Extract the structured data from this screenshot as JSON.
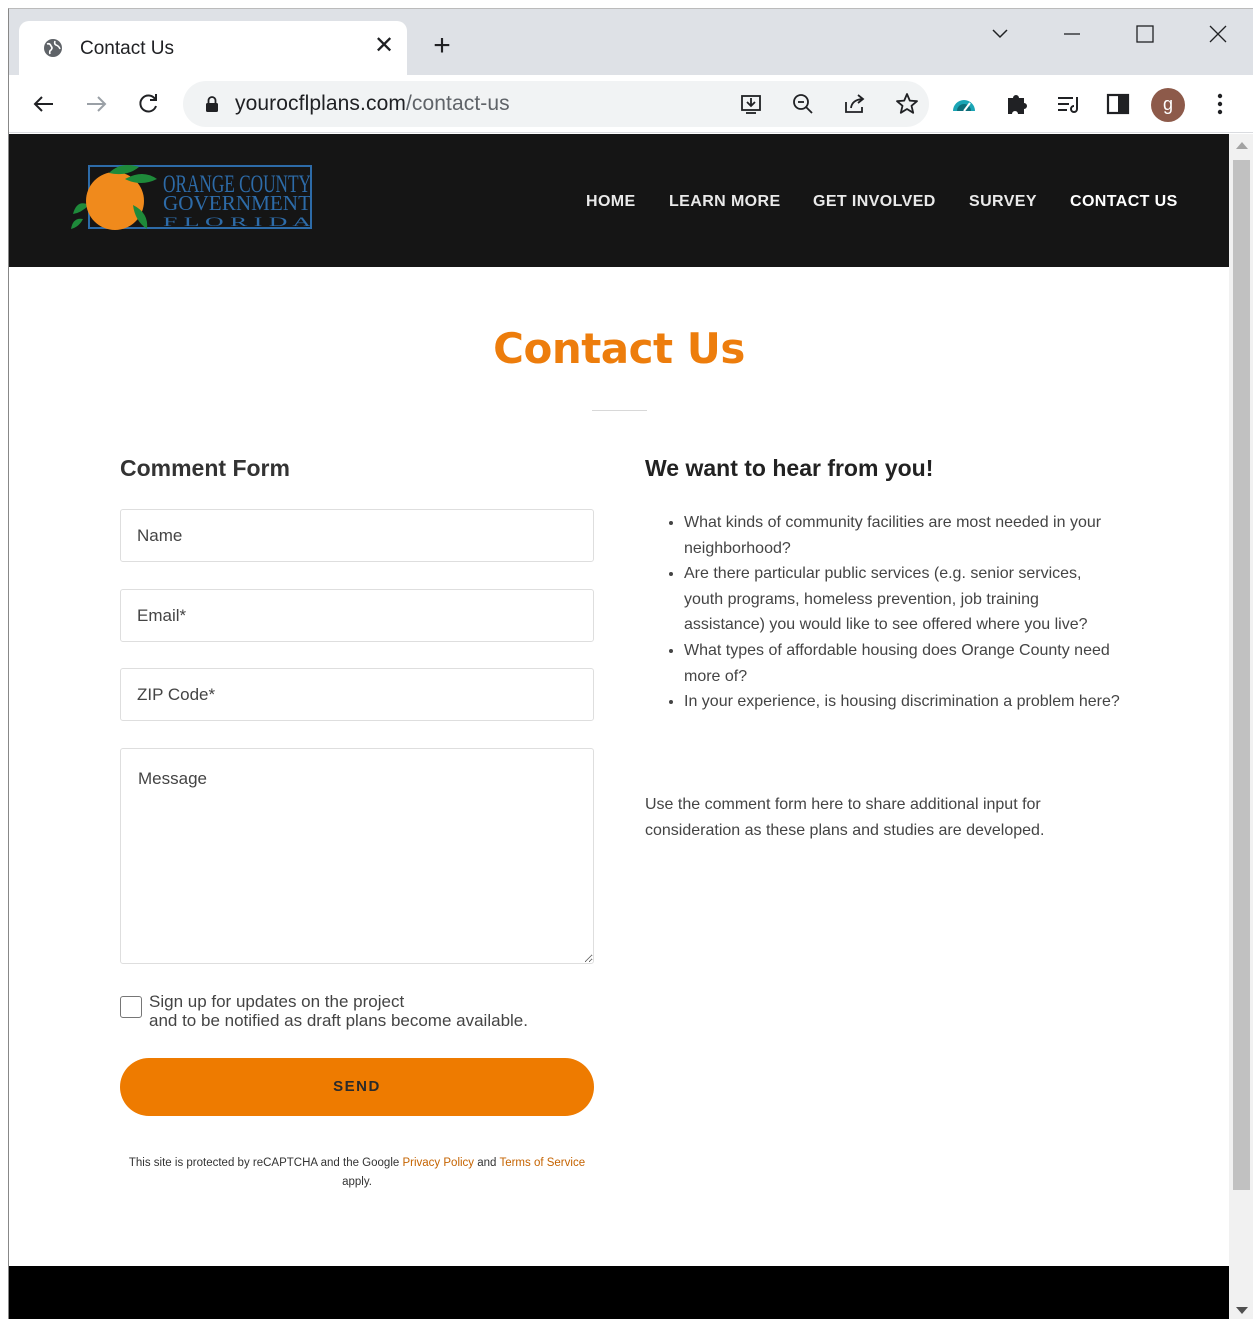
{
  "browser": {
    "tab_title": "Contact Us",
    "url_domain": "yourocflplans.com",
    "url_path": "/contact-us",
    "profile_initial": "g"
  },
  "site": {
    "logo_text": {
      "line1": "ORANGE COUNTY",
      "line2": "GOVERNMENT",
      "line3": "F L O R I D A"
    },
    "nav": [
      {
        "label": "HOME"
      },
      {
        "label": "LEARN MORE"
      },
      {
        "label": "GET INVOLVED"
      },
      {
        "label": "SURVEY"
      },
      {
        "label": "CONTACT US",
        "active": true
      }
    ]
  },
  "page": {
    "title": "Contact Us",
    "form": {
      "heading": "Comment Form",
      "name_placeholder": "Name",
      "email_placeholder": "Email*",
      "zip_placeholder": "ZIP Code*",
      "message_placeholder": "Message",
      "checkbox_line1": "Sign up for updates on the project",
      "checkbox_line2": "and to be notified as draft plans become available.",
      "submit_label": "SEND",
      "recaptcha_prefix": "This site is protected by reCAPTCHA and the Google",
      "privacy_link": "Privacy Policy",
      "recaptcha_and": "and",
      "terms_link": "Terms of Service",
      "recaptcha_suffix": "apply."
    },
    "info": {
      "heading": "We want to hear from you!",
      "questions": [
        "What kinds of community facilities are most needed in your neighborhood?",
        "Are there particular public services (e.g. senior services, youth programs, homeless prevention, job training assistance) you would like to see offered where you live?",
        "What types of affordable housing does Orange County need more of?",
        "In your experience, is housing discrimination a problem here?"
      ],
      "closing": "Use the comment form here to share additional input for consideration as these plans and studies are developed."
    }
  },
  "colors": {
    "accent": "#ee7b00",
    "header_bg": "#151515",
    "footer_bg": "#000000"
  }
}
